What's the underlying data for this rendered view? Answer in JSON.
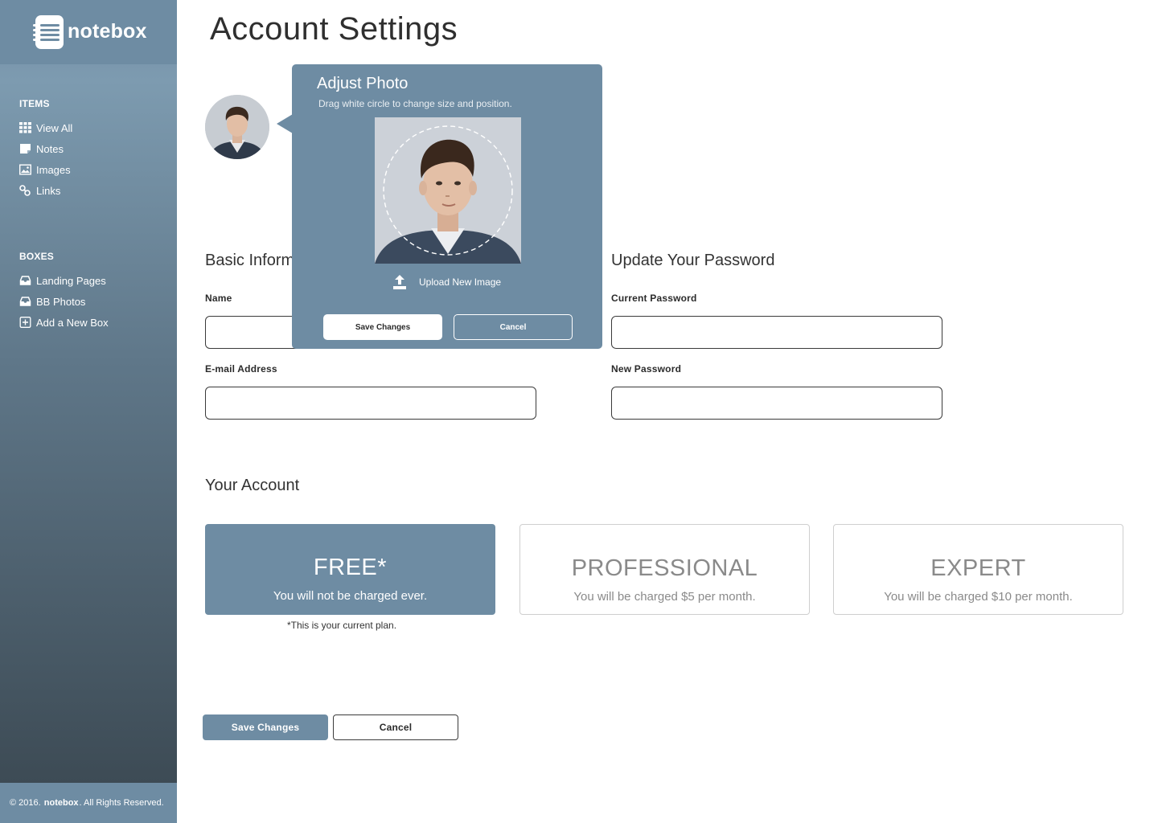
{
  "brand": {
    "name": "notebox"
  },
  "sidebar": {
    "items_title": "ITEMS",
    "items": [
      {
        "label": "View All",
        "icon": "grid-icon"
      },
      {
        "label": "Notes",
        "icon": "note-icon"
      },
      {
        "label": "Images",
        "icon": "image-icon"
      },
      {
        "label": "Links",
        "icon": "link-icon"
      }
    ],
    "boxes_title": "BOXES",
    "boxes": [
      {
        "label": "Landing Pages",
        "icon": "inbox-icon"
      },
      {
        "label": "BB Photos",
        "icon": "inbox-icon"
      },
      {
        "label": "Add a New Box",
        "icon": "plus-square-icon"
      }
    ],
    "footer": {
      "prefix": "© 2016.",
      "brand": "notebox",
      "suffix": ". All Rights Reserved."
    }
  },
  "page": {
    "title": "Account Settings"
  },
  "basic_info": {
    "heading": "Basic Information",
    "name_label": "Name",
    "name_value": "",
    "email_label": "E-mail Address",
    "email_value": ""
  },
  "password": {
    "heading": "Update Your Password",
    "current_label": "Current Password",
    "current_value": "",
    "new_label": "New Password",
    "new_value": ""
  },
  "account": {
    "heading": "Your Account",
    "plans": [
      {
        "name": "FREE*",
        "description": "You will not be charged ever.",
        "active": true
      },
      {
        "name": "PROFESSIONAL",
        "description": "You will be charged $5 per month.",
        "active": false
      },
      {
        "name": "EXPERT",
        "description": "You will be charged $10 per month.",
        "active": false
      }
    ],
    "note": "*This is your current plan."
  },
  "actions": {
    "save_label": "Save Changes",
    "cancel_label": "Cancel"
  },
  "adjust_photo": {
    "title": "Adjust Photo",
    "subtitle": "Drag white circle to change size and position.",
    "upload_label": "Upload New Image",
    "save_label": "Save Changes",
    "cancel_label": "Cancel"
  },
  "colors": {
    "accent": "#6e8ca3",
    "sidebar_dark": "#3d4b55"
  }
}
